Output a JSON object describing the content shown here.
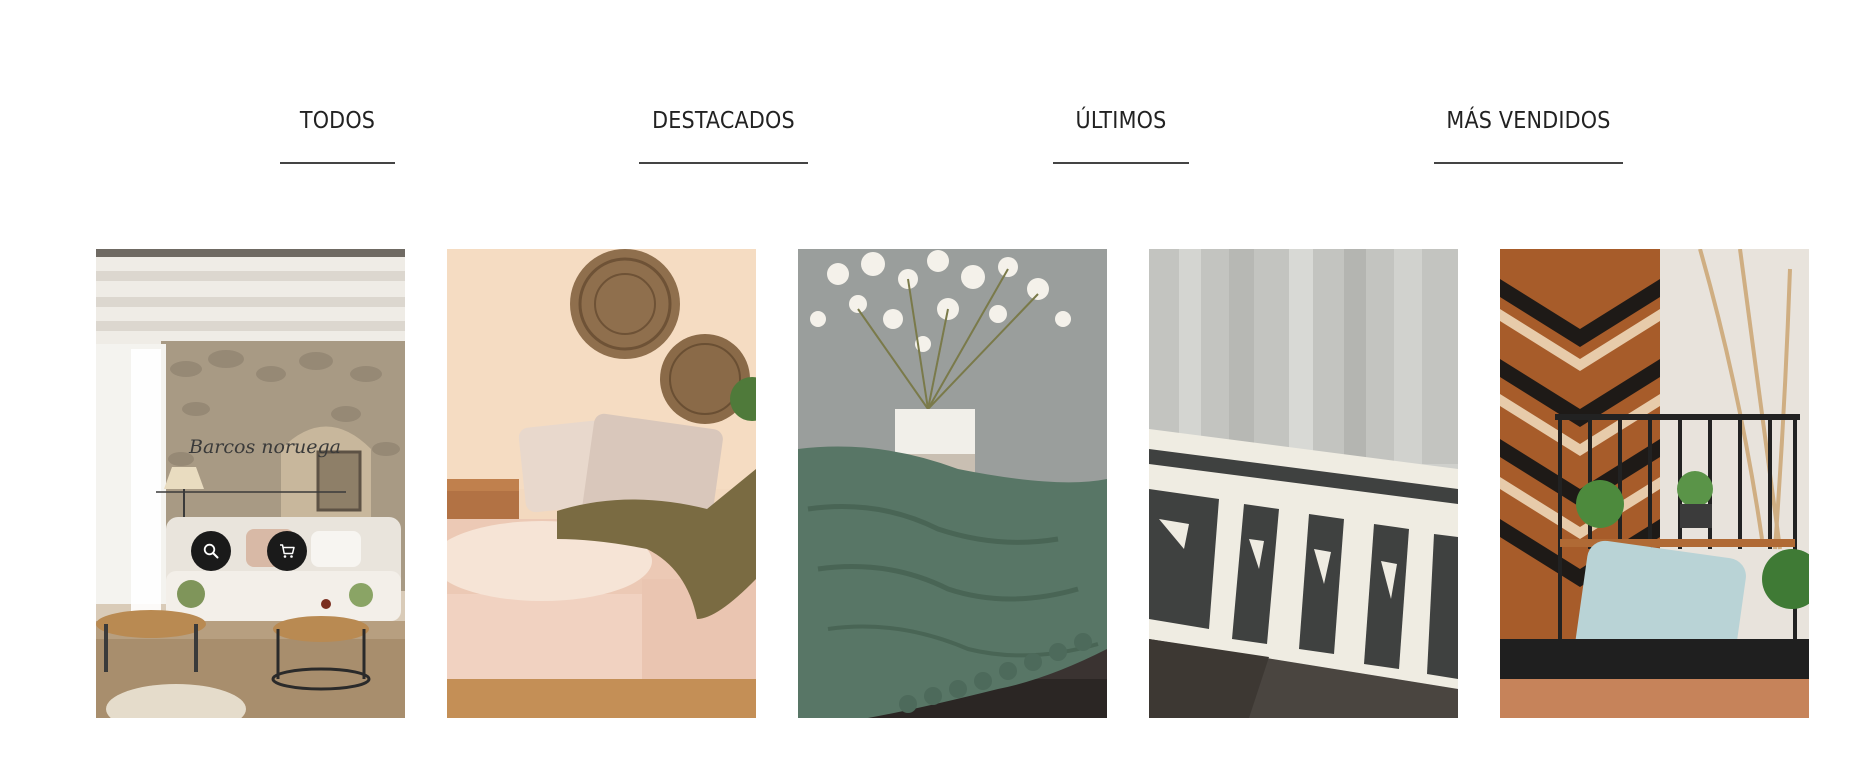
{
  "tabs": [
    {
      "label": "TODOS"
    },
    {
      "label": "DESTACADOS"
    },
    {
      "label": "ÚLTIMOS"
    },
    {
      "label": "MÁS VENDIDOS"
    }
  ],
  "products": [
    {
      "image": "living-room-stone-wall-image",
      "caption": "Barcos noruega"
    },
    {
      "image": "beige-sofa-wall-baskets-image"
    },
    {
      "image": "green-throw-white-flowers-image"
    },
    {
      "image": "sheer-curtain-patterned-rug-image"
    },
    {
      "image": "wood-chevron-panel-blue-cushion-image"
    }
  ],
  "actions": {
    "search_icon": "search-icon",
    "cart_icon": "cart-icon"
  },
  "colors": {
    "text": "#222222",
    "underline": "#444444",
    "action_bg": "#1a1a1a"
  }
}
